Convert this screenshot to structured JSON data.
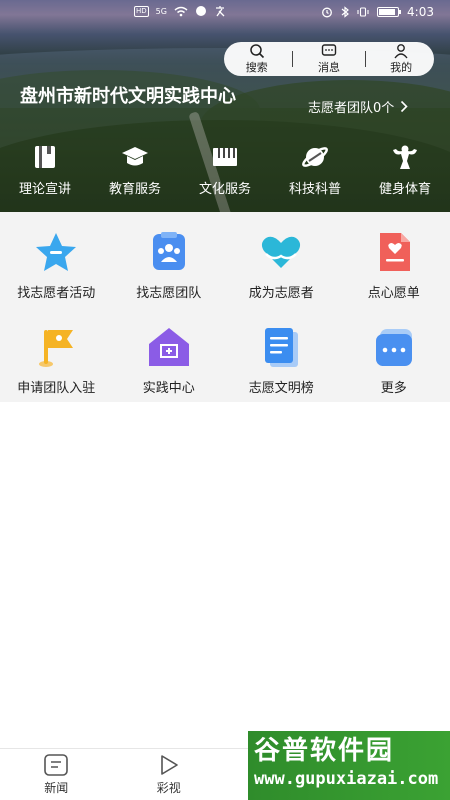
{
  "status_bar": {
    "network_badge": "HD",
    "signal_label": "5G",
    "time": "4:03"
  },
  "top_actions": [
    {
      "label": "搜索",
      "icon": "search-icon"
    },
    {
      "label": "消息",
      "icon": "message-icon"
    },
    {
      "label": "我的",
      "icon": "user-icon"
    }
  ],
  "header": {
    "center_name": "盘州市新时代文明实践中心",
    "volunteer_team_link": "志愿者团队0个"
  },
  "categories": [
    {
      "label": "理论宣讲",
      "icon": "book-icon"
    },
    {
      "label": "教育服务",
      "icon": "graduation-cap-icon"
    },
    {
      "label": "文化服务",
      "icon": "piano-icon"
    },
    {
      "label": "科技科普",
      "icon": "planet-icon"
    },
    {
      "label": "健身体育",
      "icon": "muscle-icon"
    }
  ],
  "grid": [
    {
      "label": "找志愿者活动",
      "icon": "star-icon",
      "color": "#3aa7ee"
    },
    {
      "label": "找志愿团队",
      "icon": "team-icon",
      "color": "#4a8ef0"
    },
    {
      "label": "成为志愿者",
      "icon": "heart-hands-icon",
      "color": "#2bb7d8"
    },
    {
      "label": "点心愿单",
      "icon": "wish-list-icon",
      "color": "#f0605a"
    },
    {
      "label": "申请团队入驻",
      "icon": "flag-icon",
      "color": "#f5b324"
    },
    {
      "label": "实践中心",
      "icon": "house-icon",
      "color": "#8b5ce6"
    },
    {
      "label": "志愿文明榜",
      "icon": "document-icon",
      "color": "#3b8df0"
    },
    {
      "label": "更多",
      "icon": "more-icon",
      "color": "#4a90f0"
    }
  ],
  "bottom_nav": [
    {
      "label": "新闻",
      "icon": "news-icon"
    },
    {
      "label": "彩视",
      "icon": "play-icon"
    }
  ],
  "watermark": {
    "title": "谷普软件园",
    "url": "www.gupuxiazai.com"
  }
}
